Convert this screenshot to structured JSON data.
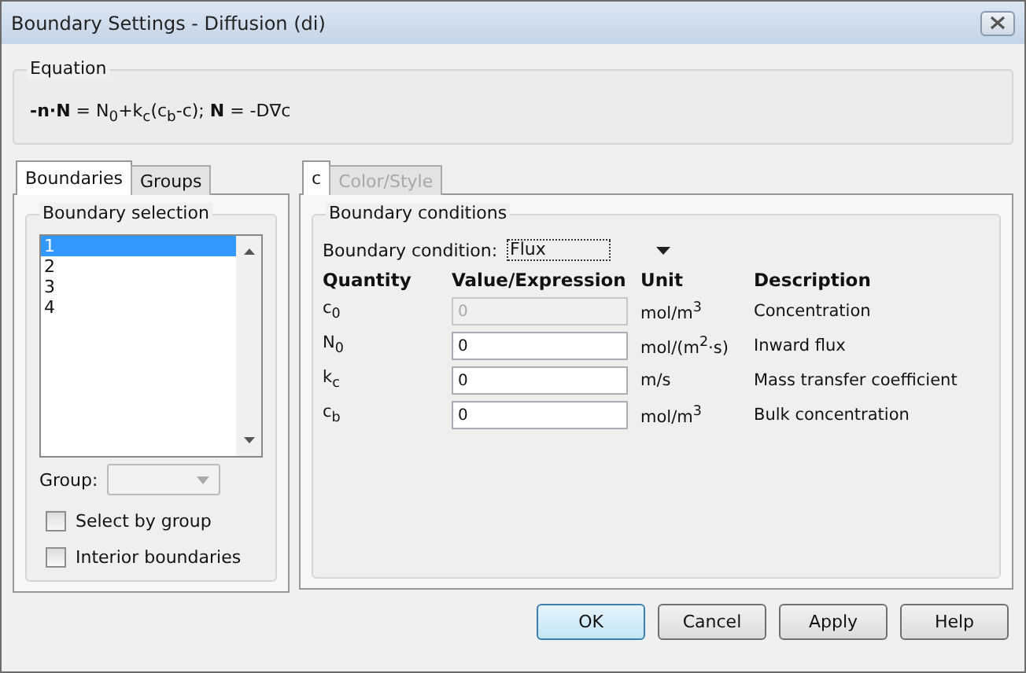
{
  "window": {
    "title": "Boundary Settings - Diffusion (di)"
  },
  "equation": {
    "label": "Equation",
    "formula": "**-n·N** = N$_{0}$+k$_{c}$(c$_{b}$-c); **N** = -D∇c"
  },
  "left_tabs": [
    {
      "label": "Boundaries",
      "selected": true
    },
    {
      "label": "Groups",
      "selected": false
    }
  ],
  "boundary_selection": {
    "label": "Boundary selection",
    "items": [
      {
        "label": "1",
        "selected": true
      },
      {
        "label": "2",
        "selected": false
      },
      {
        "label": "3",
        "selected": false
      },
      {
        "label": "4",
        "selected": false
      }
    ]
  },
  "group": {
    "label": "Group:",
    "disabled": true
  },
  "checkboxes": [
    {
      "label": "Select by group",
      "checked": false
    },
    {
      "label": "Interior boundaries",
      "checked": false
    }
  ],
  "right_tabs": [
    {
      "label": "c",
      "selected": true,
      "disabled": false
    },
    {
      "label": "Color/Style",
      "selected": false,
      "disabled": true
    }
  ],
  "boundary_conditions": {
    "label": "Boundary conditions",
    "condition_label": "Boundary condition:",
    "condition_value": "Flux",
    "columns": [
      "Quantity",
      "Value/Expression",
      "Unit",
      "Description"
    ],
    "rows": [
      {
        "quantity": "c$_{0}$",
        "value": "0",
        "disabled": true,
        "unit": "mol/m$^{3}$",
        "description": "Concentration"
      },
      {
        "quantity": "N$_{0}$",
        "value": "0",
        "disabled": false,
        "unit": "mol/(m$^{2}$·s)",
        "description": "Inward flux"
      },
      {
        "quantity": "k$_{c}$",
        "value": "0",
        "disabled": false,
        "unit": "m/s",
        "description": "Mass transfer coefficient"
      },
      {
        "quantity": "c$_{b}$",
        "value": "0",
        "disabled": false,
        "unit": "mol/m$^{3}$",
        "description": "Bulk concentration"
      }
    ]
  },
  "buttons": [
    {
      "label": "OK",
      "kind": "default"
    },
    {
      "label": "Cancel",
      "kind": "normal"
    },
    {
      "label": "Apply",
      "kind": "normal"
    },
    {
      "label": "Help",
      "kind": "normal"
    }
  ]
}
